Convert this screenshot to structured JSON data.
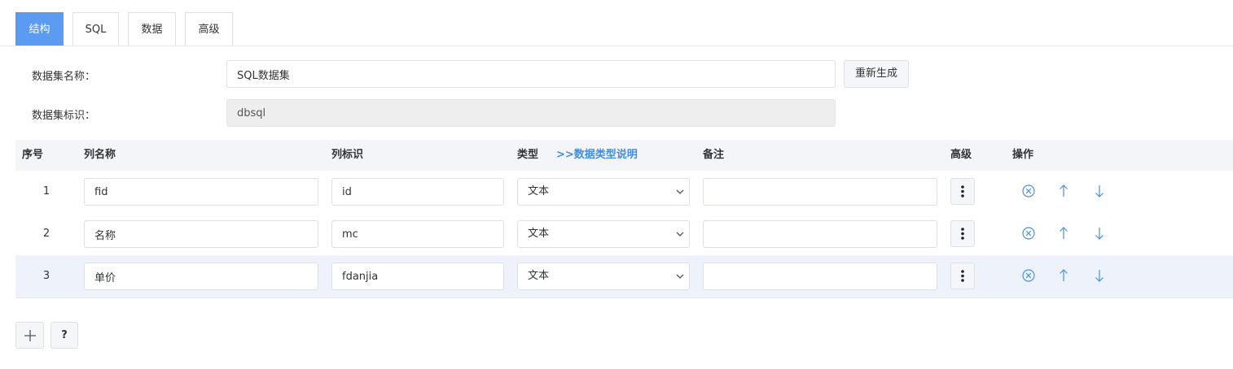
{
  "tabs": [
    {
      "label": "结构",
      "active": true
    },
    {
      "label": "SQL",
      "active": false
    },
    {
      "label": "数据",
      "active": false
    },
    {
      "label": "高级",
      "active": false
    }
  ],
  "form": {
    "name_label": "数据集名称：",
    "name_value": "SQL数据集",
    "regen_label": "重新生成",
    "id_label": "数据集标识：",
    "id_value": "dbsql"
  },
  "table": {
    "headers": {
      "index": "序号",
      "col_name": "列名称",
      "col_id": "列标识",
      "type": "类型",
      "type_help": ">>数据类型说明",
      "remark": "备注",
      "advanced": "高级",
      "actions": "操作"
    },
    "rows": [
      {
        "index": "1",
        "name": "fid",
        "id": "id",
        "type": "文本",
        "remark": ""
      },
      {
        "index": "2",
        "name": "名称",
        "id": "mc",
        "type": "文本",
        "remark": ""
      },
      {
        "index": "3",
        "name": "单价",
        "id": "fdanjia",
        "type": "文本",
        "remark": ""
      }
    ]
  },
  "footer": {
    "add_symbol": "+",
    "help_symbol": "?"
  },
  "colors": {
    "accent": "#5b9cf2",
    "link": "#3f8ee8",
    "icon_blue": "#4a90e2",
    "header_bg": "#f3f5f8",
    "row_highlight": "#eef3fb"
  }
}
